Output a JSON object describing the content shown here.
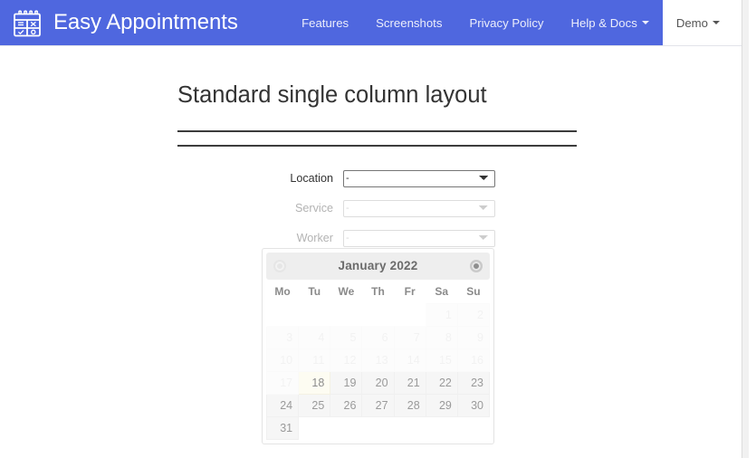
{
  "brand": {
    "name": "Easy Appointments",
    "icon": "calendar-grid-icon",
    "bg_color": "#4f67df"
  },
  "nav": {
    "items": [
      {
        "label": "Features",
        "icon": null,
        "active": false,
        "caret": false
      },
      {
        "label": "Screenshots",
        "icon": null,
        "active": false,
        "caret": false
      },
      {
        "label": "Privacy Policy",
        "icon": null,
        "active": false,
        "caret": false
      },
      {
        "label": "Help & Docs",
        "icon": "chevron-down-icon",
        "active": false,
        "caret": true
      },
      {
        "label": "Demo",
        "icon": "chevron-down-icon",
        "active": true,
        "caret": true
      }
    ]
  },
  "main": {
    "title": "Standard single column layout",
    "form": {
      "fields": [
        {
          "label": "Location",
          "value": "-",
          "disabled": false
        },
        {
          "label": "Service",
          "value": "-",
          "disabled": true
        },
        {
          "label": "Worker",
          "value": "-",
          "disabled": true
        }
      ],
      "select_options": [
        "-"
      ]
    }
  },
  "calendar": {
    "title": "January 2022",
    "prev_icon": "circle-left-arrow-icon",
    "next_icon": "circle-right-arrow-icon",
    "prev_disabled": true,
    "next_disabled": false,
    "weekdays": [
      "Mo",
      "Tu",
      "We",
      "Th",
      "Fr",
      "Sa",
      "Su"
    ],
    "weeks": [
      [
        {
          "day": "",
          "state": "empty"
        },
        {
          "day": "",
          "state": "empty"
        },
        {
          "day": "",
          "state": "empty"
        },
        {
          "day": "",
          "state": "empty"
        },
        {
          "day": "",
          "state": "empty"
        },
        {
          "day": "1",
          "state": "faded"
        },
        {
          "day": "2",
          "state": "faded"
        }
      ],
      [
        {
          "day": "3",
          "state": "faded"
        },
        {
          "day": "4",
          "state": "faded"
        },
        {
          "day": "5",
          "state": "faded"
        },
        {
          "day": "6",
          "state": "faded"
        },
        {
          "day": "7",
          "state": "faded"
        },
        {
          "day": "8",
          "state": "faded"
        },
        {
          "day": "9",
          "state": "faded"
        }
      ],
      [
        {
          "day": "10",
          "state": "faded"
        },
        {
          "day": "11",
          "state": "faded"
        },
        {
          "day": "12",
          "state": "faded"
        },
        {
          "day": "13",
          "state": "faded"
        },
        {
          "day": "14",
          "state": "faded"
        },
        {
          "day": "15",
          "state": "faded"
        },
        {
          "day": "16",
          "state": "faded"
        }
      ],
      [
        {
          "day": "17",
          "state": "faded"
        },
        {
          "day": "18",
          "state": "today"
        },
        {
          "day": "19",
          "state": "available"
        },
        {
          "day": "20",
          "state": "available"
        },
        {
          "day": "21",
          "state": "available"
        },
        {
          "day": "22",
          "state": "available"
        },
        {
          "day": "23",
          "state": "available"
        }
      ],
      [
        {
          "day": "24",
          "state": "available"
        },
        {
          "day": "25",
          "state": "available"
        },
        {
          "day": "26",
          "state": "available"
        },
        {
          "day": "27",
          "state": "available"
        },
        {
          "day": "28",
          "state": "available"
        },
        {
          "day": "29",
          "state": "available"
        },
        {
          "day": "30",
          "state": "available"
        }
      ],
      [
        {
          "day": "31",
          "state": "available"
        },
        {
          "day": "",
          "state": "empty"
        },
        {
          "day": "",
          "state": "empty"
        },
        {
          "day": "",
          "state": "empty"
        },
        {
          "day": "",
          "state": "empty"
        },
        {
          "day": "",
          "state": "empty"
        },
        {
          "day": "",
          "state": "empty"
        }
      ]
    ]
  }
}
